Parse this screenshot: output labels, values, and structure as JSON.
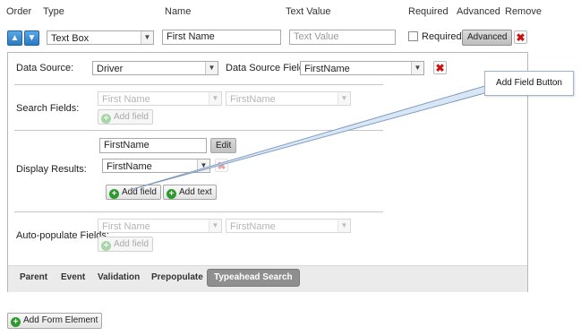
{
  "header": {
    "order": "Order",
    "type": "Type",
    "name": "Name",
    "text_value": "Text Value",
    "required": "Required",
    "advanced": "Advanced",
    "remove": "Remove"
  },
  "row": {
    "type_value": "Text Box",
    "name_value": "First Name",
    "text_value_placeholder": "Text Value",
    "required_label": "Required",
    "required_checked": false,
    "advanced_button": "Advanced"
  },
  "data_source": {
    "label": "Data Source:",
    "value": "Driver",
    "field_label": "Data Source Field:",
    "field_value": "FirstName"
  },
  "search_fields": {
    "label": "Search Fields:",
    "select1": "First Name",
    "select2": "FirstName",
    "add_field": "Add field"
  },
  "display_results": {
    "label": "Display Results:",
    "input_value": "FirstName",
    "edit_button": "Edit",
    "select_value": "FirstName",
    "add_field": "Add field",
    "add_text": "Add text"
  },
  "auto_populate": {
    "label": "Auto-populate Fields:",
    "select1": "First Name",
    "select2": "FirstName",
    "add_field": "Add field"
  },
  "tabs": [
    "Parent",
    "Event",
    "Validation",
    "Prepopulate",
    "Typeahead Search"
  ],
  "active_tab": "Typeahead Search",
  "add_form_element": "Add Form Element",
  "callout": "Add Field Button",
  "colors": {
    "accent_blue": "#2a79c4",
    "remove_red": "#cc1111",
    "add_green": "#2e9a2e",
    "active_tab": "#8f8f8f"
  }
}
